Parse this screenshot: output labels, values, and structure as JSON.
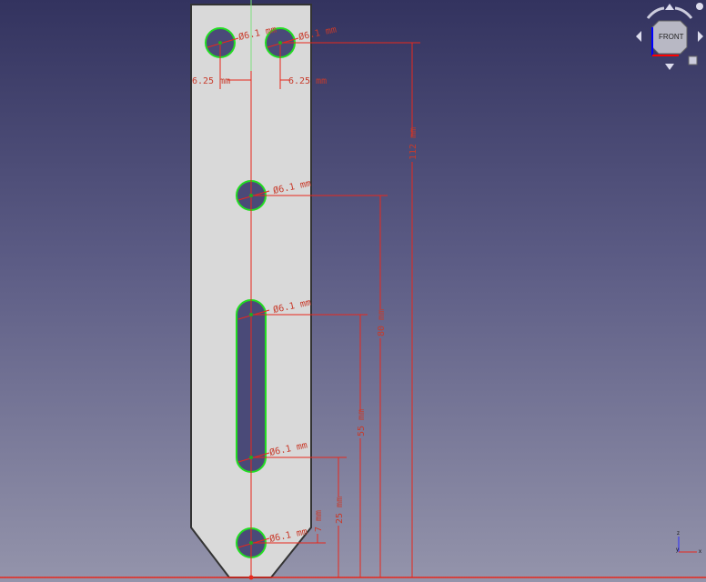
{
  "sketch": {
    "diameter_labels": [
      "Ø6.1 mm",
      "Ø6.1 mm",
      "Ø6.1 mm",
      "Ø6.1 mm",
      "Ø6.1 mm",
      "Ø6.1 mm"
    ],
    "offset_left": "6.25 mm",
    "offset_right": "6.25 mm",
    "dim_112": "112 mm",
    "dim_80": "80 mm",
    "dim_55": "55 mm",
    "dim_25": "25 mm",
    "dim_7": "7 mm"
  },
  "navcube": {
    "face": "FRONT"
  },
  "axes": {
    "x": "x",
    "y": "y",
    "z": "z"
  },
  "colors": {
    "constraint": "#e8281c",
    "edge": "#00e000",
    "part": "#d9d9d9"
  }
}
